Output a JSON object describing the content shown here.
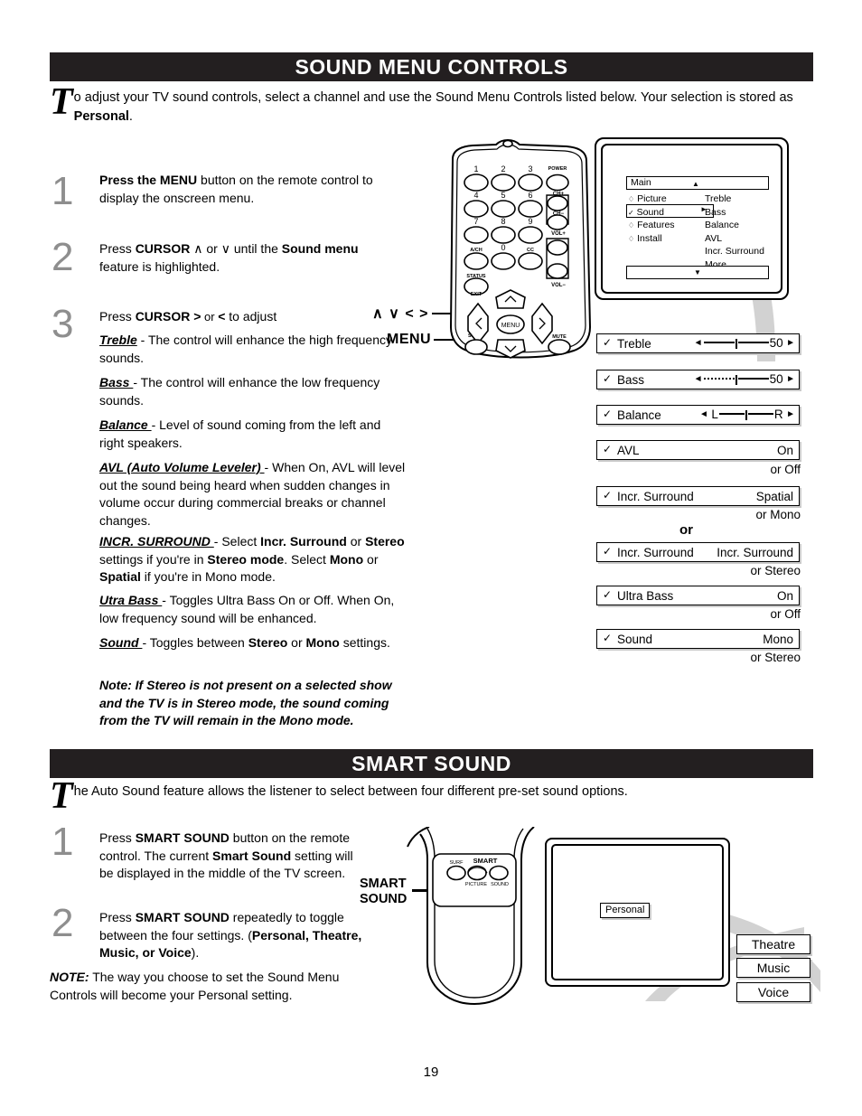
{
  "page": {
    "number": "19"
  },
  "sections": {
    "sound_menu": {
      "banner_title": "SOUND MENU CONTROLS",
      "intro_dropcap": "T",
      "intro_text_1": "o adjust your TV sound controls, select a channel and use the Sound Menu Controls listed below. Your selection is stored as ",
      "intro_bold": "Personal",
      "intro_text_2": "."
    },
    "smart_sound": {
      "banner_title": "SMART SOUND",
      "intro_dropcap": "T",
      "intro_text": "he Auto Sound feature allows the listener to select between four different pre-set sound options."
    }
  },
  "steps_sound": [
    {
      "number": "1",
      "parts": [
        {
          "t": "Press the MENU",
          "b": true
        },
        {
          "t": " button on the remote control to display the onscreen menu.",
          "b": false
        }
      ]
    },
    {
      "number": "2",
      "parts": [
        {
          "t": "Press ",
          "b": false
        },
        {
          "t": "CURSOR",
          "b": true
        },
        {
          "t": "  ∧  or ∨ until the ",
          "b": false
        },
        {
          "t": "Sound menu",
          "b": true
        },
        {
          "t": " feature is highlighted.",
          "b": false
        }
      ]
    },
    {
      "number": "3",
      "parts": [
        {
          "t": "Press ",
          "b": false
        },
        {
          "t": "CURSOR >",
          "b": true
        },
        {
          "t": "  or  ",
          "b": false
        },
        {
          "t": "<",
          "b": true
        },
        {
          "t": " to adjust",
          "b": false
        }
      ]
    }
  ],
  "definitions": [
    {
      "term": "Treble",
      "body": " - The control will enhance the high frequency sounds."
    },
    {
      "term": "Bass ",
      "body": " -  The control will enhance the low frequency sounds."
    },
    {
      "term": "Balance ",
      "body": " -  Level of sound coming from the left and right speakers."
    },
    {
      "term": "AVL (Auto Volume Leveler) ",
      "body": "-  When On, AVL will level out the sound being heard when sudden changes in volume occur during commercial breaks or channel changes."
    },
    {
      "term": "INCR. SURROUND ",
      "body": " -  Select ",
      "rich": [
        {
          "t": " -  Select ",
          "b": false
        },
        {
          "t": "Incr. Surround",
          "b": true
        },
        {
          "t": " or ",
          "b": false
        },
        {
          "t": "Stereo",
          "b": true
        },
        {
          "t": " settings if you're in ",
          "b": false
        },
        {
          "t": "Stereo mode",
          "b": true
        },
        {
          "t": ".   Select ",
          "b": false
        },
        {
          "t": "Mono",
          "b": true
        },
        {
          "t": " or ",
          "b": false
        },
        {
          "t": "Spatial",
          "b": true
        },
        {
          "t": " if you're in Mono mode.",
          "b": false
        }
      ]
    },
    {
      "term": "Utra Bass ",
      "body": " -   Toggles Ultra Bass On or Off.  When On,  low frequency sound will be enhanced."
    },
    {
      "term": "Sound ",
      "body": " -   Toggles between ",
      "rich": [
        {
          "t": " -   Toggles between ",
          "b": false
        },
        {
          "t": "Stereo",
          "b": true
        },
        {
          "t": " or ",
          "b": false
        },
        {
          "t": "Mono",
          "b": true
        },
        {
          "t": " settings.",
          "b": false
        }
      ]
    }
  ],
  "note_sound": "Note: If  Stereo is not present on a selected show and the TV is in Stereo mode, the sound coming from the TV will remain in the Mono mode.",
  "callouts": {
    "cursor_keys": "∧ ∨ < >",
    "menu": "MENU",
    "smart_sound_line1": "SMART",
    "smart_sound_line2": "SOUND"
  },
  "remote_top": {
    "keys": [
      "1",
      "2",
      "3",
      "4",
      "5",
      "6",
      "7",
      "8",
      "9",
      "0"
    ],
    "labels": {
      "power": "POWER",
      "ch_up": "CH+",
      "ch_down": "CH−",
      "vol_up": "VOL+",
      "vol_down": "VOL−",
      "a_ch": "A/CH",
      "cc": "CC",
      "status": "STATUS",
      "exit": "EXIT",
      "sleep": "SLEEP",
      "mute": "MUTE",
      "menu": "MENU"
    }
  },
  "remote_bottom": {
    "labels": {
      "surf": "SURF",
      "smart": "SMART",
      "picture": "PICTURE",
      "sound": "SOUND"
    }
  },
  "osd_menu": {
    "header_label": "Main",
    "header_arrow": "▲",
    "footer_arrow": "▼",
    "left_items": [
      {
        "marker": "♢",
        "label": "Picture",
        "selected": false
      },
      {
        "marker": "✓",
        "label": "Sound",
        "selected": true
      },
      {
        "marker": "♢",
        "label": "Features",
        "selected": false
      },
      {
        "marker": "♢",
        "label": "Install",
        "selected": false
      }
    ],
    "right_items": [
      "Treble",
      "Bass",
      "Balance",
      "AVL",
      "Incr. Surround",
      "More ..."
    ]
  },
  "setting_rows": [
    {
      "name": "Treble",
      "check": "✓",
      "kind": "slider",
      "slider_style": "solid",
      "value": "50",
      "left_arrow": "◄",
      "right_arrow": "►",
      "sub": ""
    },
    {
      "name": "Bass",
      "check": "✓",
      "kind": "slider",
      "slider_style": "dashed",
      "value": "50",
      "left_arrow": "◄",
      "right_arrow": "►",
      "sub": ""
    },
    {
      "name": "Balance",
      "check": "✓",
      "kind": "balance",
      "left_label": "L",
      "right_label": "R",
      "left_arrow": "◄",
      "right_arrow": "►",
      "sub": ""
    },
    {
      "name": "AVL",
      "check": "✓",
      "kind": "value",
      "value": "On",
      "sub": "or Off"
    },
    {
      "name": "Incr. Surround",
      "check": "✓",
      "kind": "value",
      "value": "Spatial",
      "sub": "or Mono"
    },
    {
      "name": "Incr. Surround",
      "check": "✓",
      "kind": "value",
      "value": "Incr. Surround",
      "sub": "or Stereo"
    },
    {
      "name": "Ultra Bass",
      "check": "✓",
      "kind": "value",
      "value": "On",
      "sub": "or Off"
    },
    {
      "name": "Sound",
      "check": "✓",
      "kind": "value",
      "value": "Mono",
      "sub": "or Stereo"
    }
  ],
  "or_separator": "or",
  "steps_smart": [
    {
      "number": "1",
      "parts": [
        {
          "t": "Press ",
          "b": false
        },
        {
          "t": "SMART SOUND",
          "b": true
        },
        {
          "t": " button on the remote control.  The current ",
          "b": false
        },
        {
          "t": "Smart Sound",
          "b": true
        },
        {
          "t": " setting will be displayed in the middle of the TV screen.",
          "b": false
        }
      ]
    },
    {
      "number": "2",
      "parts": [
        {
          "t": "Press ",
          "b": false
        },
        {
          "t": "SMART  SOUND",
          "b": true
        },
        {
          "t": " repeatedly to toggle between the four settings. (",
          "b": false
        },
        {
          "t": "Personal, Theatre, Music, or Voice",
          "b": true
        },
        {
          "t": ").",
          "b": false
        }
      ]
    }
  ],
  "note_smart": {
    "label": "NOTE:",
    "text": " The way you choose to set the Sound Menu Controls will become your Personal setting."
  },
  "smart_tv": {
    "current_setting": "Personal",
    "presets": [
      "Theatre",
      "Music",
      "Voice"
    ]
  },
  "colors": {
    "banner_bg": "#231f20",
    "step_number": "#8e8e8e",
    "swoosh_grey": "#d2d2d2",
    "shadow_grey": "#c9c9c9"
  }
}
